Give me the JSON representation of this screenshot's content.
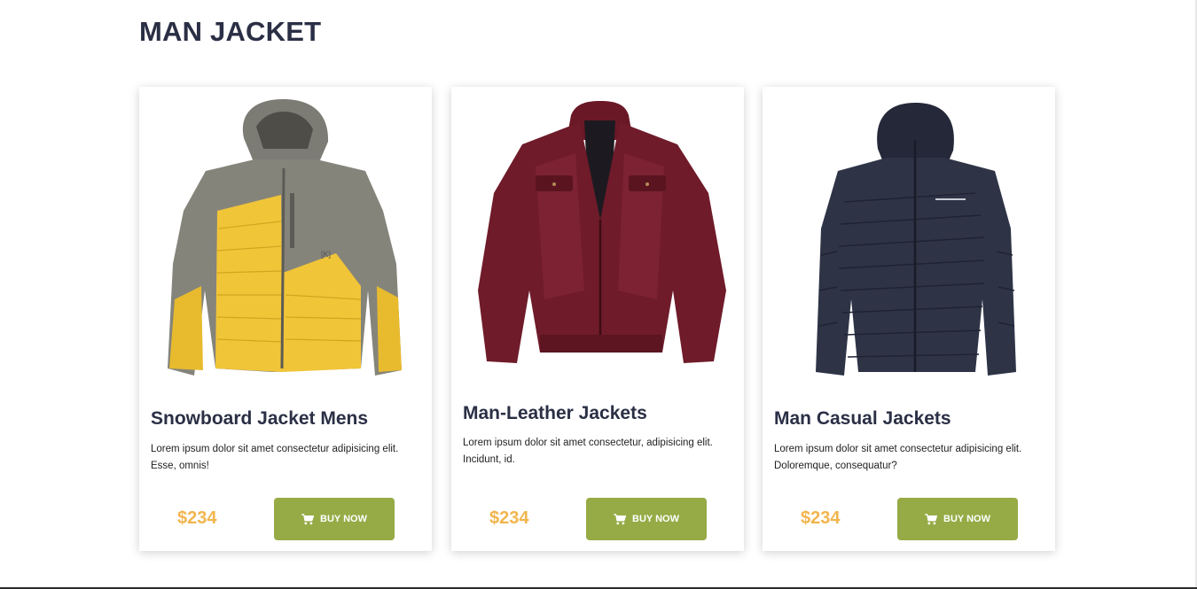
{
  "page": {
    "title": "MAN JACKET"
  },
  "products": [
    {
      "name": "Snowboard Jacket Mens",
      "description": "Lorem ipsum dolor sit amet consectetur adipisicing elit. Esse, omnis!",
      "price": "$234",
      "buy_label": "BUY NOW",
      "image_icon": "yellow-grey-snowboard-jacket-image"
    },
    {
      "name": "Man-Leather Jackets",
      "description": "Lorem ipsum dolor sit amet consectetur, adipisicing elit. Incidunt, id.",
      "price": "$234",
      "buy_label": "BUY NOW",
      "image_icon": "burgundy-leather-jacket-image"
    },
    {
      "name": "Man Casual Jackets",
      "description": "Lorem ipsum dolor sit amet consectetur adipisicing elit. Doloremque, consequatur?",
      "price": "$234",
      "buy_label": "BUY NOW",
      "image_icon": "navy-puffer-jacket-image"
    }
  ],
  "colors": {
    "title": "#2a2f45",
    "price": "#f2b54e",
    "button": "#96ab46"
  },
  "icons": {
    "buy": "cart-icon"
  }
}
